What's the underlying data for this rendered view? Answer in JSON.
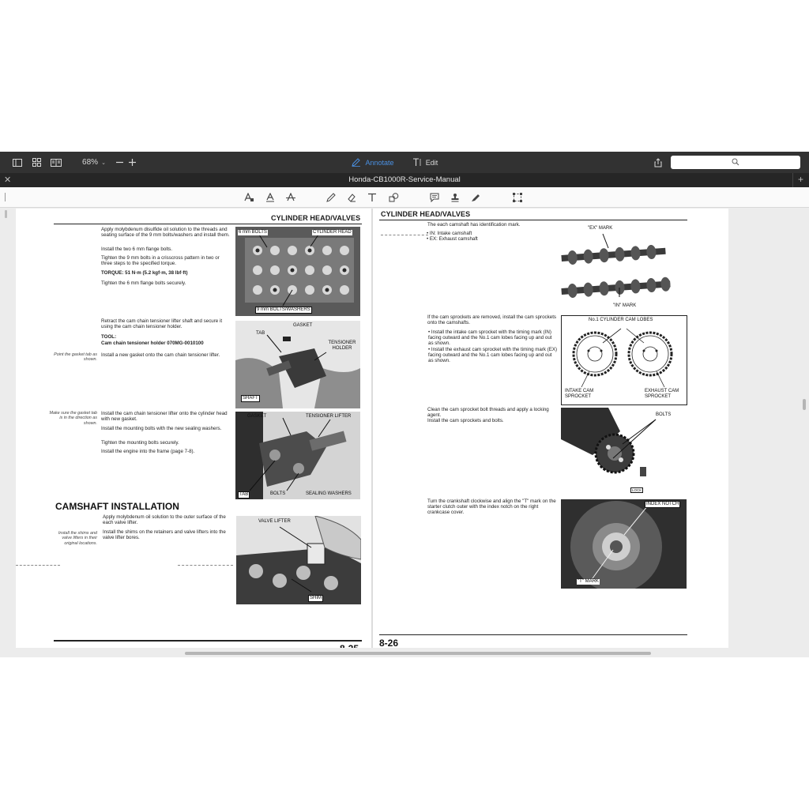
{
  "toolbar": {
    "zoom": "68%",
    "zoom_caret": "⌄",
    "annotate_label": "Annotate",
    "edit_label": "Edit",
    "search_placeholder": ""
  },
  "titlebar": {
    "title": "Honda-CB1000R-Service-Manual",
    "close": "✕",
    "new_tab": "+"
  },
  "colors": {
    "toolbar_bg": "#323232",
    "title_bg": "#262626",
    "accent": "#4a90e2",
    "page_bg": "#ffffff"
  },
  "left_page": {
    "header": "CYLINDER HEAD/VALVES",
    "block1": {
      "p1": "Apply molybdenum disulfide oil solution to the threads and seating surface of the 9 mm bolts/washers and install them.",
      "p2": "Install the two 6 mm flange bolts.",
      "p3": "Tighten the 9 mm bolts in a crisscross pattern in two or three steps to the specified torque.",
      "torque": "TORQUE: 51 N·m (5.2 kgf·m, 38 lbf·ft)",
      "p4": "Tighten the 6 mm flange bolts securely.",
      "fig_labels": {
        "a": "6 mm BOLTS",
        "b": "CYLINDER HEAD",
        "c": "9 mm BOLTS/WASHERS"
      }
    },
    "block2": {
      "p1": "Retract the cam chain tensioner lifter shaft and secure it using the cam chain tensioner holder.",
      "tool_hdr": "TOOL:",
      "tool": "Cam chain tensioner holder     070MG-0010100",
      "side": "Point the gasket tab as shown.",
      "p2": "Install a new gasket onto the cam chain tensioner lifter.",
      "fig_labels": {
        "a": "GASKET",
        "b": "TAB",
        "c": "TENSIONER HOLDER",
        "d": "SHAFT"
      }
    },
    "block3": {
      "side": "Make sure the gasket tab is in the direction as shown.",
      "p1": "Install the cam chain tensioner lifter onto the cylinder head with new gasket.",
      "p2": "Install the mounting bolts with the new sealing washers.",
      "p3": "Tighten the mounting bolts securely.",
      "p4": "Install the engine into the frame (page 7-8).",
      "fig_labels": {
        "a": "GASKET",
        "b": "TENSIONER LIFTER",
        "c": "TAB",
        "d": "BOLTS",
        "e": "SEALING WASHERS"
      }
    },
    "section_title": "CAMSHAFT INSTALLATION",
    "block4": {
      "p1": "Apply molybdenum oil solution to the outer surface of the each valve lifter.",
      "side": "Install the shims and valve lifters in their original locations.",
      "p2": "Install the shims on the retainers and valve lifters into the valve lifter bores.",
      "fig_labels": {
        "a": "VALVE LIFTER",
        "b": "SHIM"
      }
    },
    "page_number": "8-25"
  },
  "right_page": {
    "header": "CYLINDER HEAD/VALVES",
    "block1": {
      "p1": "The each camshaft has identification mark.",
      "b1": "IN: Intake camshaft",
      "b2": "EX: Exhaust camshaft",
      "fig_labels": {
        "a": "\"EX\" MARK",
        "b": "\"IN\" MARK"
      }
    },
    "block2": {
      "p1": "If the cam sprockets are removed, install the cam sprockets onto the camshafts.",
      "b1": "Install the intake cam sprocket with the timing mark (IN) facing outward and the No.1 cam lobes facing up and out as shown.",
      "b2": "Install the exhaust cam sprocket with the timing mark (EX) facing outward and the No.1 cam lobes facing up and out as shown.",
      "fig_labels": {
        "a": "No.1 CYLINDER CAM LOBES",
        "b": "INTAKE CAM SPROCKET",
        "c": "EXHAUST CAM SPROCKET"
      }
    },
    "block3": {
      "p1": "Clean the cam sprocket bolt threads and apply a locking agent.",
      "p2": "Install the cam sprockets and bolts.",
      "fig_labels": {
        "a": "BOLTS",
        "b": "LOCK"
      }
    },
    "block4": {
      "p1": "Turn the crankshaft clockwise and align the \"T\" mark on the starter clutch outer with the index notch on the right crankcase cover.",
      "fig_labels": {
        "a": "INDEX NOTCH",
        "b": "\"T\" MARK"
      }
    },
    "page_number": "8-26"
  }
}
